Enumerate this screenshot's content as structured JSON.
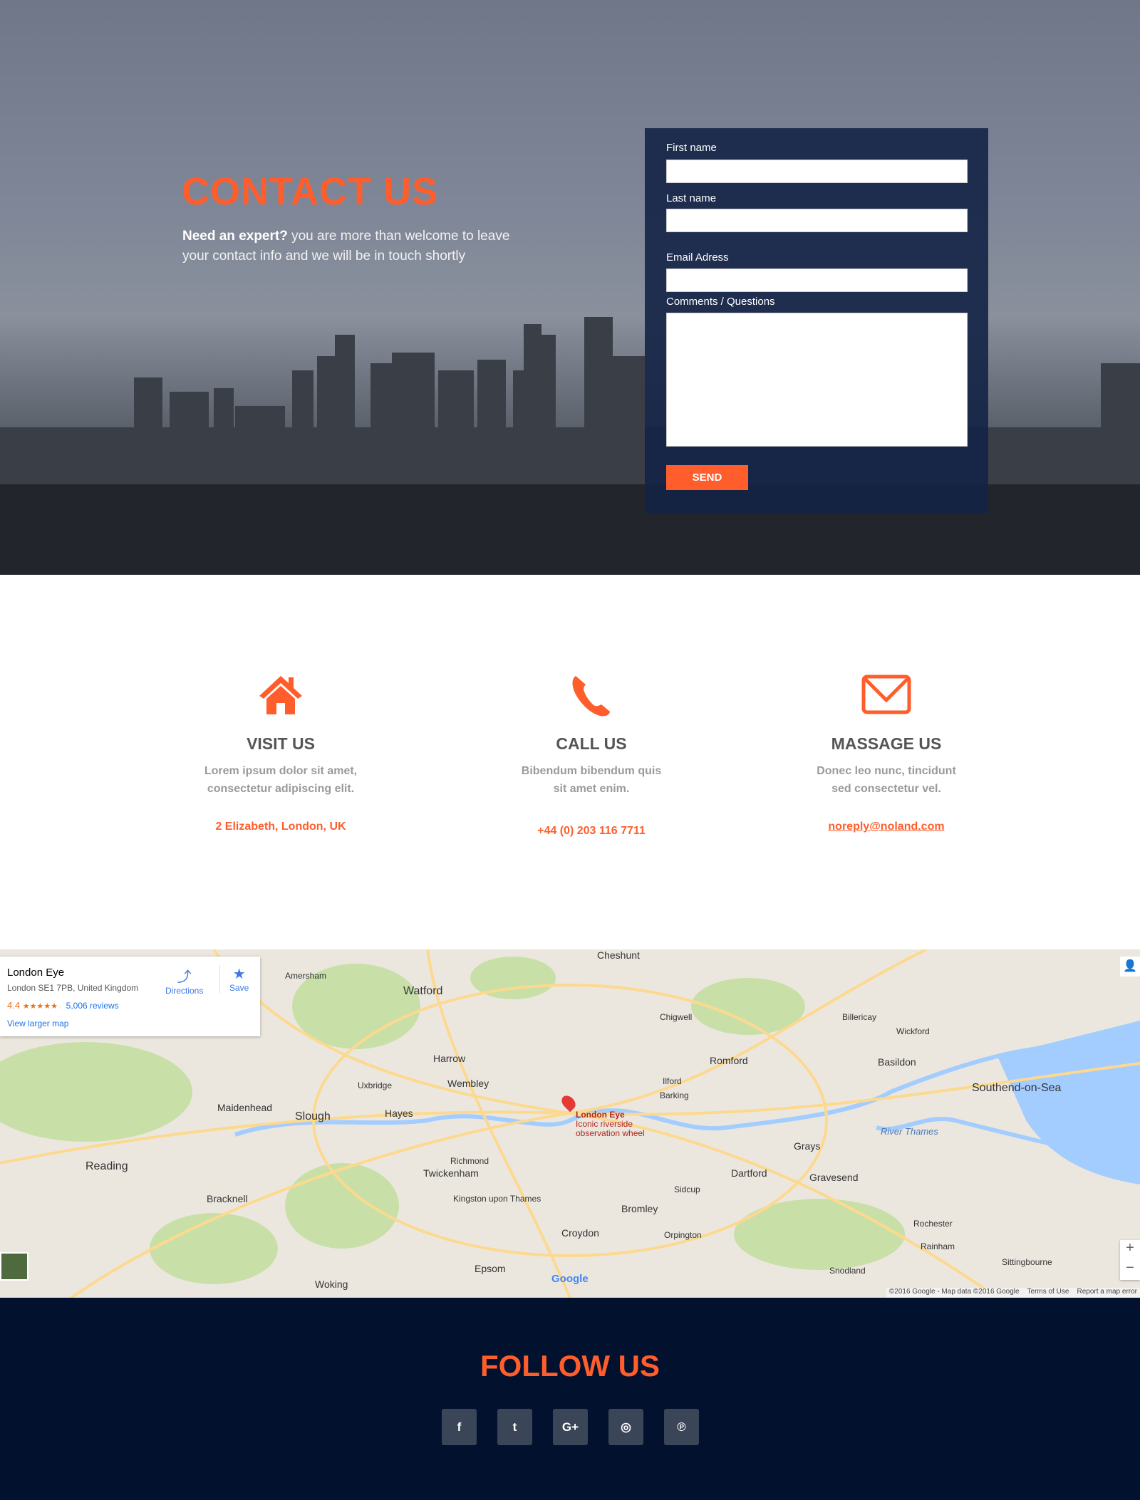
{
  "hero": {
    "title": "CONTACT US",
    "intro_bold": "Need an expert?",
    "intro_text": " you are more than welcome to leave your contact info and we will be in touch shortly"
  },
  "form": {
    "first_name_label": "First name",
    "last_name_label": "Last name",
    "email_label": "Email Adress",
    "comments_label": "Comments / Questions",
    "first_name_value": "",
    "last_name_value": "",
    "email_value": "",
    "comments_value": "",
    "send_label": "SEND"
  },
  "info": [
    {
      "icon": "home-icon",
      "title": "VISIT US",
      "text1": "Lorem ipsum dolor sit amet,",
      "text2": "consectetur adipiscing elit.",
      "contact": "2 Elizabeth, London, UK"
    },
    {
      "icon": "phone-icon",
      "title": "CALL US",
      "text1": "Bibendum bibendum quis",
      "text2": "sit amet enim.",
      "contact": "+44 (0) 203 116 7711"
    },
    {
      "icon": "envelope-icon",
      "title": "MASSAGE US",
      "text1": "Donec leo nunc, tincidunt",
      "text2": "sed consectetur vel.",
      "contact": "noreply@noland.com"
    }
  ],
  "map": {
    "place_name": "London Eye",
    "address": "London SE1 7PB, United Kingdom",
    "rating": "4.4",
    "stars": "★★★★★",
    "reviews": "5,006 reviews",
    "view_larger": "View larger map",
    "directions": "Directions",
    "save": "Save",
    "marker_title": "London Eye",
    "marker_sub1": "Iconic riverside",
    "marker_sub2": "observation wheel",
    "labels": [
      "Watford",
      "Harrow",
      "Wembley",
      "Slough",
      "Hayes",
      "Reading",
      "Maidenhead",
      "Twickenham",
      "Richmond",
      "Croydon",
      "Bromley",
      "Romford",
      "Basildon",
      "Southend-on-Sea",
      "Dartford",
      "Grays",
      "Gravesend",
      "Epsom",
      "Woking",
      "Bracknell",
      "Ilford",
      "Barking",
      "Chigwell",
      "Billericay",
      "Wickford",
      "Rochester",
      "Sittingbourne",
      "River Thames",
      "Cheshunt",
      "Amersham",
      "Uxbridge",
      "Kingston upon Thames",
      "Sidcup",
      "Orpington",
      "Snodland",
      "Rainham"
    ],
    "zoom_in": "+",
    "zoom_out": "−",
    "copyright": "©2016 Google - Map data ©2016 Google",
    "terms": "Terms of Use",
    "report": "Report a map error",
    "google": "Google",
    "colors": {
      "land": "#ebe7df",
      "park": "#c8e0a8",
      "water": "#a3ccff",
      "road": "#fcd98f"
    }
  },
  "footer": {
    "title": "FOLLOW US",
    "social": [
      {
        "icon": "facebook-icon",
        "glyph": "f"
      },
      {
        "icon": "twitter-icon",
        "glyph": "t"
      },
      {
        "icon": "google-plus-icon",
        "glyph": "G+"
      },
      {
        "icon": "instagram-icon",
        "glyph": "◎"
      },
      {
        "icon": "pinterest-icon",
        "glyph": "℗"
      }
    ]
  },
  "colors": {
    "accent": "#ff5e2c",
    "footer_bg": "#02112e",
    "form_bg": "#142346"
  }
}
